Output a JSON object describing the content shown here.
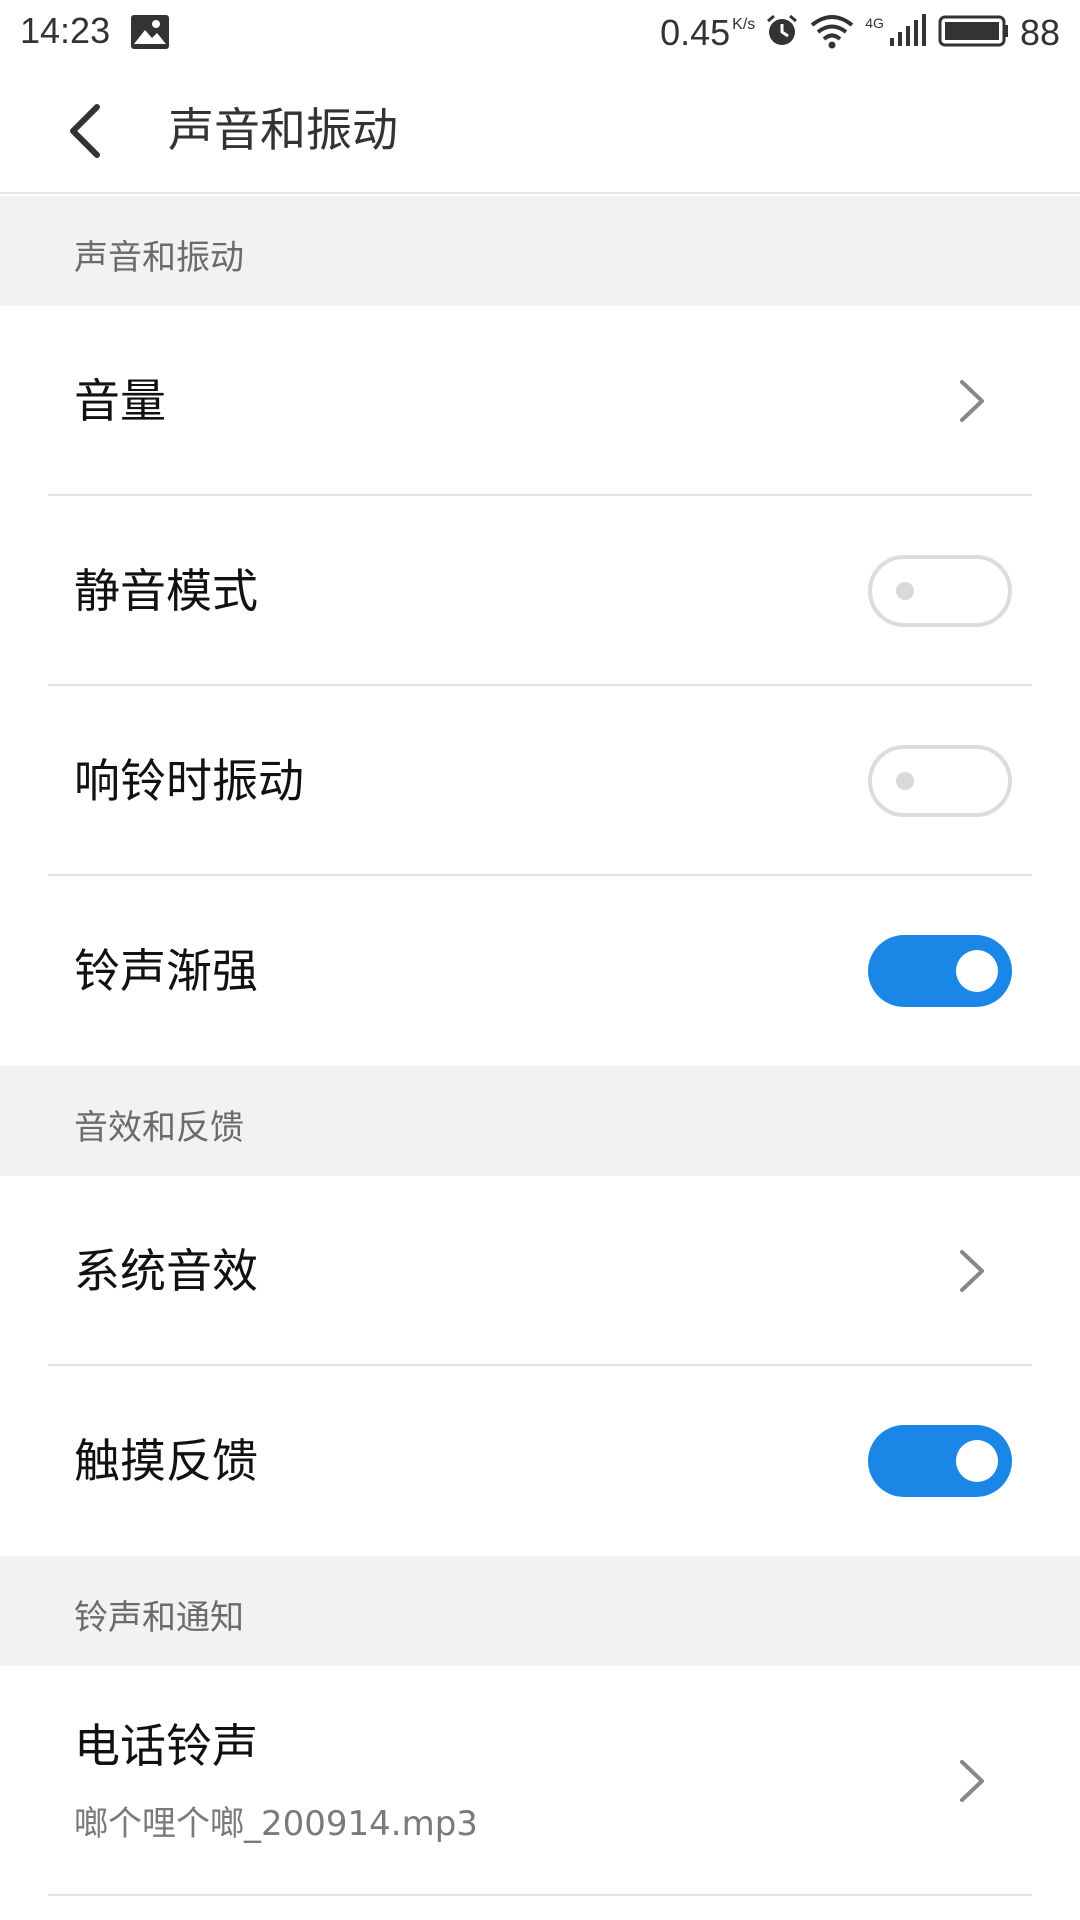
{
  "status_bar": {
    "time": "14:23",
    "network_speed": "0.45",
    "network_speed_unit": "K/s",
    "network_type": "4G",
    "battery_level": "88",
    "icons": [
      "image-notification-icon",
      "alarm-icon",
      "wifi-icon",
      "cell-signal-icon",
      "battery-icon"
    ]
  },
  "app_bar": {
    "title": "声音和振动",
    "back_icon": "back-arrow-icon"
  },
  "sections": [
    {
      "header": "声音和振动",
      "rows": [
        {
          "label": "音量",
          "control": "chevron"
        },
        {
          "label": "静音模式",
          "control": "toggle",
          "on": false
        },
        {
          "label": "响铃时振动",
          "control": "toggle",
          "on": false
        },
        {
          "label": "铃声渐强",
          "control": "toggle",
          "on": true
        }
      ]
    },
    {
      "header": "音效和反馈",
      "rows": [
        {
          "label": "系统音效",
          "control": "chevron"
        },
        {
          "label": "触摸反馈",
          "control": "toggle",
          "on": true
        }
      ]
    },
    {
      "header": "铃声和通知",
      "rows": [
        {
          "label": "电话铃声",
          "sublabel": "啷个哩个啷_200914.mp3",
          "control": "chevron"
        }
      ]
    }
  ],
  "colors": {
    "accent": "#1a87e6",
    "section_bg": "#f2f2f2",
    "toggle_off_border": "#dcdcdc"
  }
}
